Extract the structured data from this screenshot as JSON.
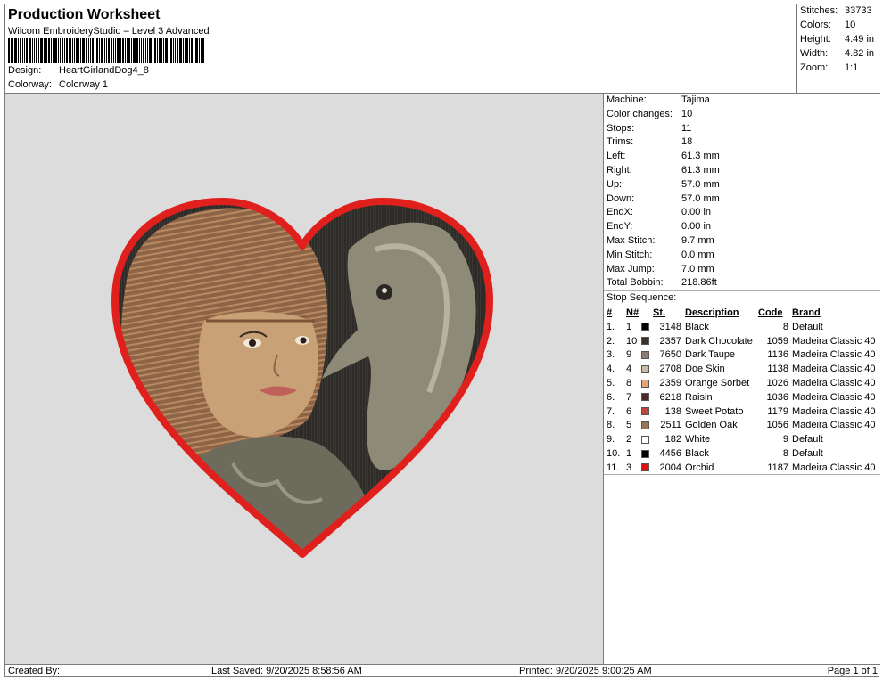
{
  "header": {
    "title": "Production Worksheet",
    "subtitle": "Wilcom EmbroideryStudio – Level 3 Advanced",
    "design_label": "Design:",
    "design_value": "HeartGirlandDog4_8",
    "colorway_label": "Colorway:",
    "colorway_value": "Colorway 1"
  },
  "stats": [
    {
      "label": "Stitches:",
      "value": "33733"
    },
    {
      "label": "Colors:",
      "value": "10"
    },
    {
      "label": "Height:",
      "value": "4.49 in"
    },
    {
      "label": "Width:",
      "value": "4.82 in"
    },
    {
      "label": "Zoom:",
      "value": "1:1"
    }
  ],
  "machine_info": [
    {
      "label": "Machine:",
      "value": "Tajima"
    },
    {
      "label": "Color changes:",
      "value": "10"
    },
    {
      "label": "Stops:",
      "value": "11"
    },
    {
      "label": "Trims:",
      "value": "18"
    },
    {
      "label": "Left:",
      "value": "61.3 mm"
    },
    {
      "label": "Right:",
      "value": "61.3 mm"
    },
    {
      "label": "Up:",
      "value": "57.0 mm"
    },
    {
      "label": "Down:",
      "value": "57.0 mm"
    },
    {
      "label": "EndX:",
      "value": "0.00 in"
    },
    {
      "label": "EndY:",
      "value": "0.00 in"
    },
    {
      "label": "Max Stitch:",
      "value": "9.7 mm"
    },
    {
      "label": "Min Stitch:",
      "value": "0.0 mm"
    },
    {
      "label": "Max Jump:",
      "value": "7.0 mm"
    },
    {
      "label": "Total Bobbin:",
      "value": "218.86ft"
    }
  ],
  "stop_sequence": {
    "label": "Stop Sequence:",
    "headers": {
      "num": "#",
      "n": "N#",
      "st": "St.",
      "desc": "Description",
      "code": "Code",
      "brand": "Brand"
    },
    "rows": [
      {
        "num": "1.",
        "n": "1",
        "color": "#000000",
        "st": "3148",
        "desc": "Black",
        "code": "8",
        "brand": "Default"
      },
      {
        "num": "2.",
        "n": "10",
        "color": "#3b2f28",
        "st": "2357",
        "desc": "Dark Chocolate",
        "code": "1059",
        "brand": "Madeira Classic 40"
      },
      {
        "num": "3.",
        "n": "9",
        "color": "#8c7b6e",
        "st": "7650",
        "desc": "Dark Taupe",
        "code": "1136",
        "brand": "Madeira Classic 40"
      },
      {
        "num": "4.",
        "n": "4",
        "color": "#c9bca2",
        "st": "2708",
        "desc": "Doe Skin",
        "code": "1138",
        "brand": "Madeira Classic 40"
      },
      {
        "num": "5.",
        "n": "8",
        "color": "#e6a07a",
        "st": "2359",
        "desc": "Orange Sorbet",
        "code": "1026",
        "brand": "Madeira Classic 40"
      },
      {
        "num": "6.",
        "n": "7",
        "color": "#4a2a24",
        "st": "6218",
        "desc": "Raisin",
        "code": "1036",
        "brand": "Madeira Classic 40"
      },
      {
        "num": "7.",
        "n": "6",
        "color": "#c0443a",
        "st": "138",
        "desc": "Sweet Potato",
        "code": "1179",
        "brand": "Madeira Classic 40"
      },
      {
        "num": "8.",
        "n": "5",
        "color": "#9a7650",
        "st": "2511",
        "desc": "Golden Oak",
        "code": "1056",
        "brand": "Madeira Classic 40"
      },
      {
        "num": "9.",
        "n": "2",
        "color": "#ffffff",
        "st": "182",
        "desc": "White",
        "code": "9",
        "brand": "Default"
      },
      {
        "num": "10.",
        "n": "1",
        "color": "#000000",
        "st": "4456",
        "desc": "Black",
        "code": "8",
        "brand": "Default"
      },
      {
        "num": "11.",
        "n": "3",
        "color": "#e01010",
        "st": "2004",
        "desc": "Orchid",
        "code": "1187",
        "brand": "Madeira Classic 40"
      }
    ]
  },
  "footer": {
    "created_by": "Created By:",
    "last_saved": "Last Saved: 9/20/2025 8:58:56 AM",
    "printed": "Printed: 9/20/2025 9:00:25 AM",
    "page": "Page 1 of 1"
  }
}
